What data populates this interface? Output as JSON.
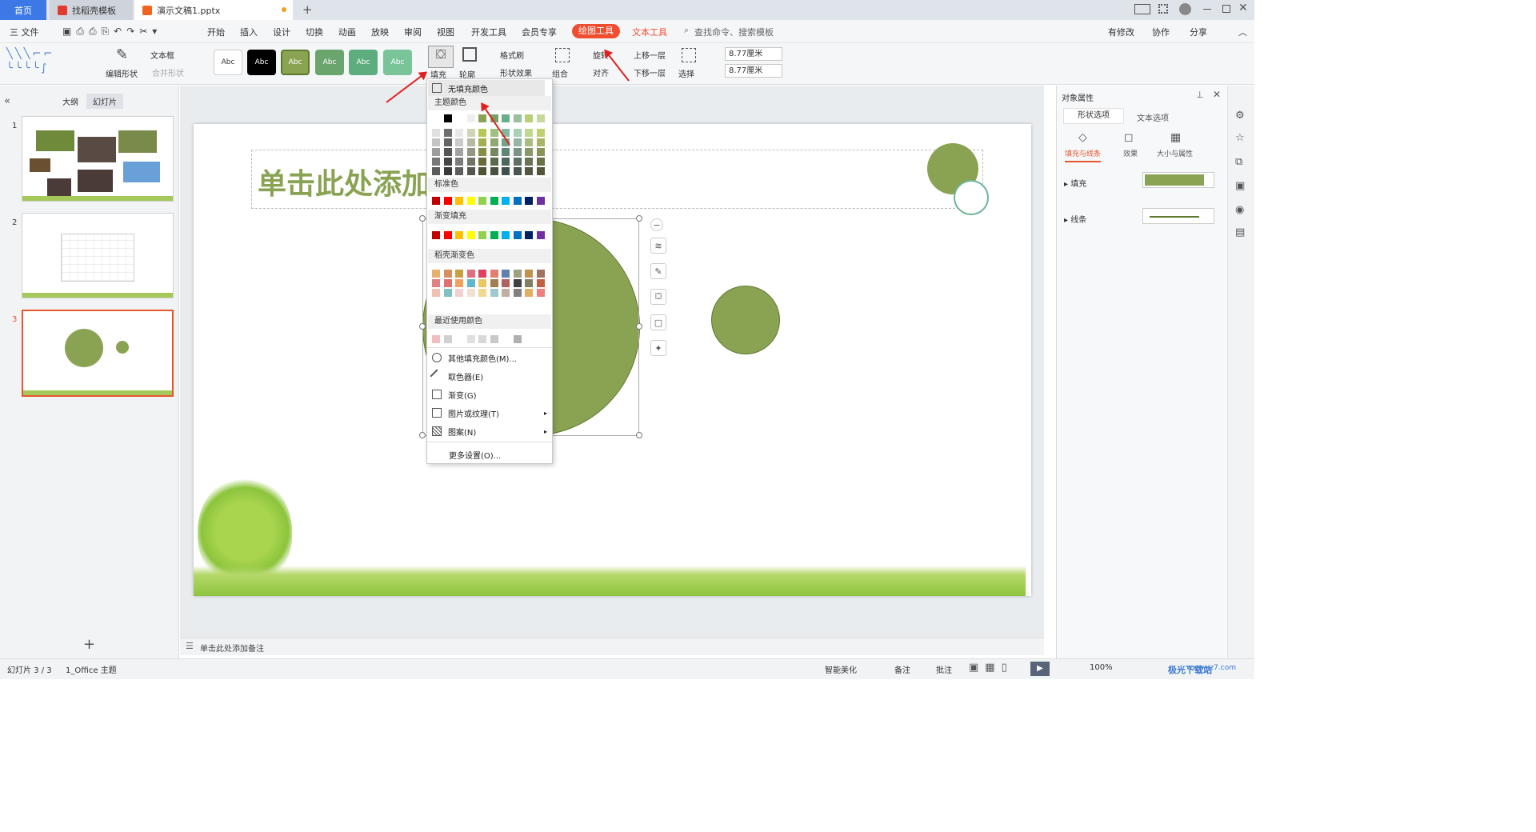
{
  "tabs": {
    "home": "首页",
    "template": "找稻壳模板",
    "document": "演示文稿1.pptx",
    "add": "+"
  },
  "menu": {
    "file": "三 文件",
    "items": [
      "开始",
      "插入",
      "设计",
      "切换",
      "动画",
      "放映",
      "审阅",
      "视图",
      "开发工具",
      "会员专享"
    ],
    "drawing_tools": "绘图工具",
    "text_tools": "文本工具",
    "search": "查找命令、搜索模板",
    "modified": "有修改",
    "collab": "协作",
    "share": "分享"
  },
  "ribbon": {
    "edit_shape": "编辑形状",
    "textbox": "文本框",
    "merge_shape": "合并形状",
    "style_label": "Abc",
    "fill": "填充",
    "outline": "轮廓",
    "format_brush": "格式刷",
    "shape_effect": "形状效果",
    "combine": "组合",
    "rotate": "旋转",
    "align": "对齐",
    "bring_forward": "上移一层",
    "send_backward": "下移一层",
    "select": "选择",
    "height": "8.77厘米",
    "width": "8.77厘米"
  },
  "left_pane": {
    "outline_tab": "大纲",
    "slides_tab": "幻灯片",
    "slide_numbers": [
      "1",
      "2",
      "3"
    ],
    "add": "+"
  },
  "slide": {
    "title_placeholder": "单击此处添加"
  },
  "notes_placeholder": "单击此处添加备注",
  "dropdown": {
    "no_fill": "无填充颜色",
    "theme_colors": "主题颜色",
    "standard_colors": "标准色",
    "gradient_fill": "渐变填充",
    "docer_gradient": "稻壳渐变色",
    "recent_colors": "最近使用颜色",
    "more_fill": "其他填充颜色(M)...",
    "eyedropper": "取色器(E)",
    "gradient": "渐变(G)",
    "picture_texture": "图片或纹理(T)",
    "pattern": "图案(N)",
    "more_settings": "更多设置(O)..."
  },
  "right_pane": {
    "title": "对象属性",
    "tab_shape": "形状选项",
    "tab_text": "文本选项",
    "sub_fill_line": "填充与线条",
    "sub_effect": "效果",
    "sub_size": "大小与属性",
    "fill_label": "填充",
    "line_label": "线条"
  },
  "status": {
    "slide_count": "幻灯片 3 / 3",
    "theme": "1_Office 主题",
    "smart": "智能美化",
    "notes": "备注",
    "comment": "批注",
    "zoom": "100%"
  },
  "watermark": {
    "name": "极光下载站",
    "url": "www.xz7.com"
  },
  "colors": {
    "accent": "#8aa353",
    "drawing_tab": "#f04e30",
    "home_tab": "#3c79e6",
    "arrow": "#e02020"
  }
}
